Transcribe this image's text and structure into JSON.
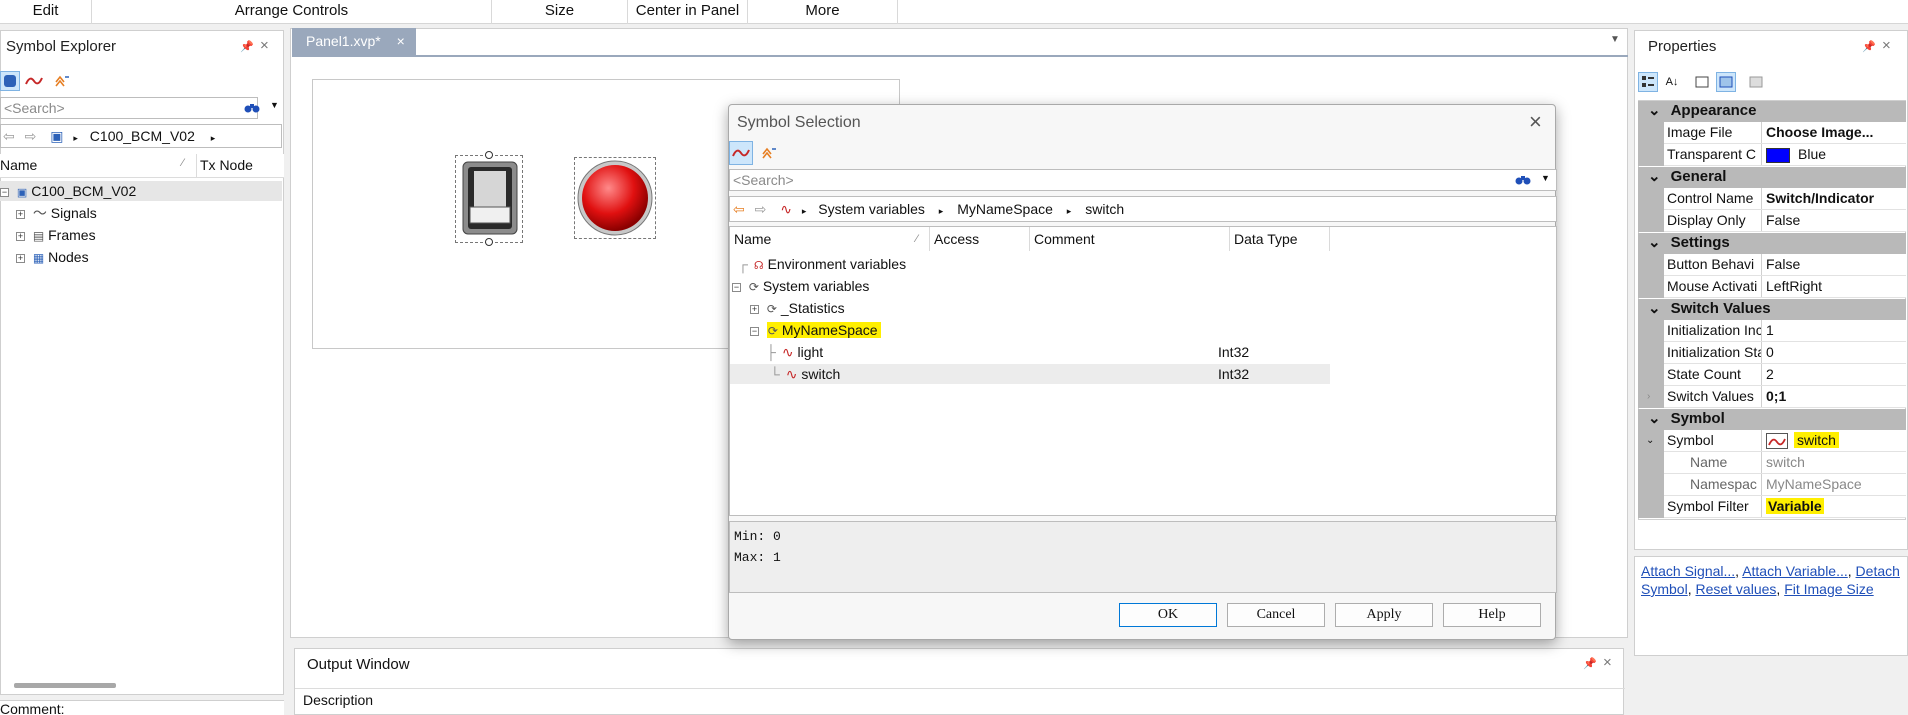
{
  "ribbon": {
    "edit": "Edit",
    "arrange": "Arrange Controls",
    "size": "Size",
    "center": "Center in Panel",
    "more": "More"
  },
  "symbol_explorer": {
    "title": "Symbol Explorer",
    "search_placeholder": "<Search>",
    "breadcrumb": "C100_BCM_V02",
    "col_name": "Name",
    "col_txnode": "Tx Node",
    "tree": {
      "root": "C100_BCM_V02",
      "signals": "Signals",
      "frames": "Frames",
      "nodes": "Nodes"
    },
    "comment_label": "Comment:"
  },
  "editor": {
    "tab_label": "Panel1.xvp*"
  },
  "output_window": {
    "title": "Output Window",
    "col_description": "Description"
  },
  "dialog": {
    "title": "Symbol Selection",
    "search_placeholder": "<Search>",
    "breadcrumb": [
      "System variables",
      "MyNameSpace",
      "switch"
    ],
    "columns": {
      "name": "Name",
      "access": "Access",
      "comment": "Comment",
      "data_type": "Data Type"
    },
    "tree": {
      "env": "Environment variables",
      "sys": "System variables",
      "stats": "_Statistics",
      "ns": "MyNameSpace",
      "light": "light",
      "light_type": "Int32",
      "switch": "switch",
      "switch_type": "Int32"
    },
    "info": {
      "min": "Min:  0",
      "max": "Max:  1"
    },
    "buttons": {
      "ok": "OK",
      "cancel": "Cancel",
      "apply": "Apply",
      "help": "Help"
    }
  },
  "properties": {
    "title": "Properties",
    "categories": {
      "appearance": "Appearance",
      "general": "General",
      "settings": "Settings",
      "switch_values": "Switch Values",
      "symbol": "Symbol"
    },
    "rows": {
      "image_file": {
        "name": "Image File",
        "value": "Choose Image..."
      },
      "transparent": {
        "name": "Transparent C",
        "value": "Blue",
        "color": "#0000ff"
      },
      "control_name": {
        "name": "Control Name",
        "value": "Switch/Indicator"
      },
      "display_only": {
        "name": "Display Only",
        "value": "False"
      },
      "button_behavior": {
        "name": "Button Behavi",
        "value": "False"
      },
      "mouse_activation": {
        "name": "Mouse Activati",
        "value": "LeftRight"
      },
      "init_index": {
        "name": "Initialization Inc",
        "value": "1"
      },
      "init_state": {
        "name": "Initialization Sta",
        "value": "0"
      },
      "state_count": {
        "name": "State Count",
        "value": "2"
      },
      "switch_values": {
        "name": "Switch Values",
        "value": "0;1"
      },
      "symbol": {
        "name": "Symbol",
        "value": "switch"
      },
      "sym_name": {
        "name": "Name",
        "value": "switch"
      },
      "sym_namespace": {
        "name": "Namespac",
        "value": "MyNameSpace"
      },
      "symbol_filter": {
        "name": "Symbol Filter",
        "value": "Variable"
      }
    },
    "links": {
      "attach_signal": "Attach Signal...",
      "attach_variable": "Attach Variable...",
      "detach_symbol": "Detach Symbol",
      "reset_values": "Reset values",
      "fit_image": "Fit Image Size"
    }
  },
  "colors": {
    "accent": "#0078d7",
    "highlight": "#ffef00",
    "category": "#b9b9b9",
    "tab_active": "#9aa8bc"
  }
}
